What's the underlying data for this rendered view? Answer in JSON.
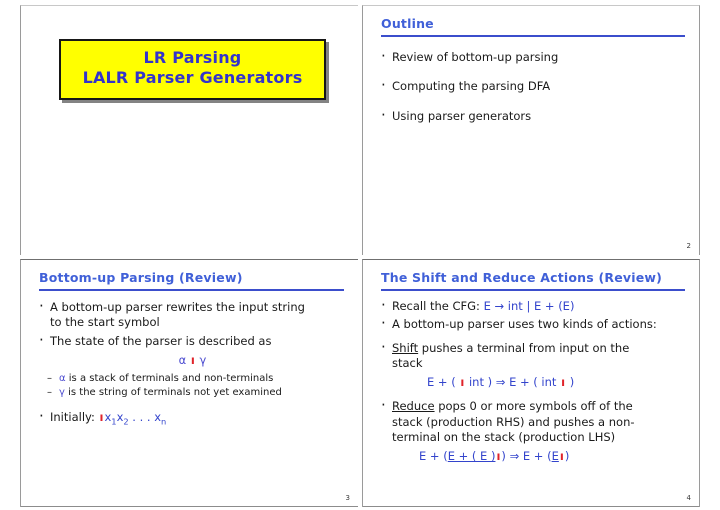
{
  "slides": [
    {
      "id": "slide-title",
      "page_number": "",
      "title_box": {
        "line1": "LR Parsing",
        "line2": "LALR Parser Generators",
        "bg_color": "#ffff00",
        "text_color": "#3333cc",
        "border_color": "#171717"
      }
    },
    {
      "id": "slide-outline",
      "header": "Outline",
      "page_number": "2",
      "items": [
        "Review of bottom-up parsing",
        "Computing the parsing DFA",
        "Using parser generators"
      ]
    },
    {
      "id": "slide-bottom-up",
      "header": "Bottom-up Parsing (Review)",
      "page_number": "3",
      "bullet1_line1": "A bottom-up parser rewrites the input string",
      "bullet1_line2": "to the start symbol",
      "bullet2": "The state of the parser is described as",
      "state_notation": {
        "alpha": "α",
        "bar": "ı",
        "gamma": "γ"
      },
      "sub1_symbol": "α",
      "sub1_text": "is a stack of terminals and non-terminals",
      "sub2_symbol": "γ",
      "sub2_text": "is the string of terminals not yet examined",
      "initially_label": "Initially:",
      "initially_bar": "ı",
      "initially_x1": "x",
      "initially_sub1": "1",
      "initially_x2": "x",
      "initially_sub2": "2",
      "initially_dots": ". . .",
      "initially_xn": "x",
      "initially_subn": "n"
    },
    {
      "id": "slide-shift-reduce",
      "header": "The Shift and Reduce Actions (Review)",
      "page_number": "4",
      "recall_label": "Recall the CFG:",
      "cfg": "E → int | E + (E)",
      "bullet_two_kinds": "A bottom-up parser uses two kinds of actions:",
      "shift_word": "Shift",
      "shift_line1": "pushes a terminal from input on the",
      "shift_line2": "stack",
      "shift_example": {
        "part1": "E + (",
        "bar1": "ı",
        "part2": "int )",
        "arrow": "⇒",
        "part3": "E + ( int",
        "bar2": "ı",
        "part4": ")"
      },
      "reduce_word": "Reduce",
      "reduce_line1": "pops 0 or more symbols off of the",
      "reduce_line2": "stack (production RHS) and pushes a non-",
      "reduce_line3": "terminal on the stack (production LHS)",
      "reduce_example": {
        "pre": "E + (",
        "underlined1": "E + ( E )",
        "bar1": "ı",
        "mid": ")",
        "arrow": "⇒",
        "post": "E + (",
        "underlined2": "E",
        "bar2": "ı",
        "end": ")"
      }
    }
  ]
}
